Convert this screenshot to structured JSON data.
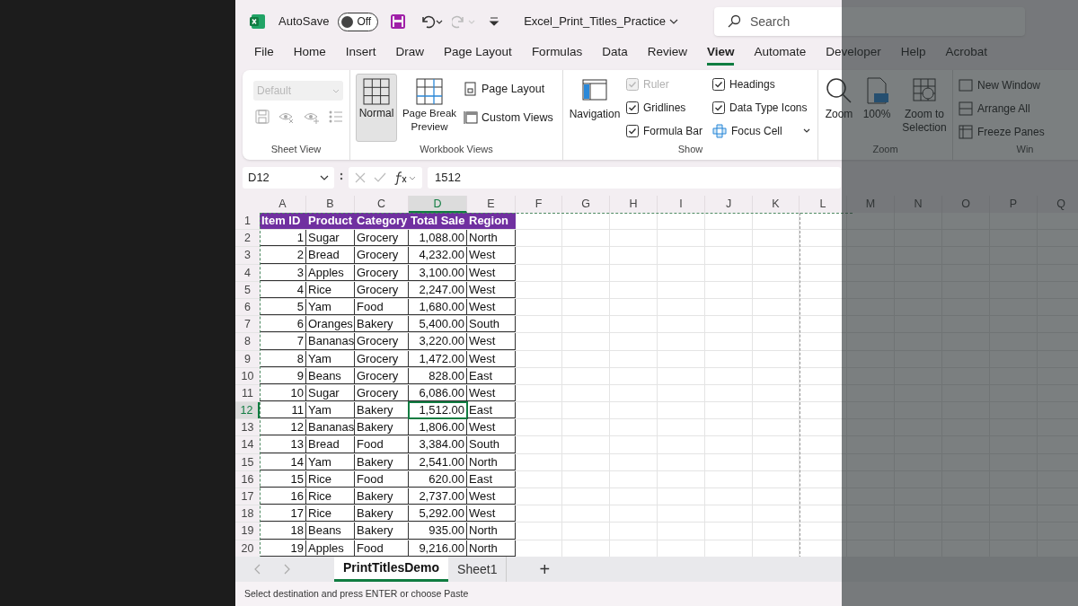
{
  "title_bar": {
    "autosave_label": "AutoSave",
    "autosave_toggle": {
      "label": "Off",
      "on": false
    },
    "file_name": "Excel_Print_Titles_Practice",
    "search": {
      "placeholder": "Search"
    }
  },
  "ribbon_tabs": [
    {
      "label": "File",
      "selected": false
    },
    {
      "label": "Home",
      "selected": false
    },
    {
      "label": "Insert",
      "selected": false
    },
    {
      "label": "Draw",
      "selected": false
    },
    {
      "label": "Page Layout",
      "selected": false
    },
    {
      "label": "Formulas",
      "selected": false
    },
    {
      "label": "Data",
      "selected": false
    },
    {
      "label": "Review",
      "selected": false
    },
    {
      "label": "View",
      "selected": true
    },
    {
      "label": "Automate",
      "selected": false
    },
    {
      "label": "Developer",
      "selected": false
    },
    {
      "label": "Help",
      "selected": false
    },
    {
      "label": "Acrobat",
      "selected": false
    }
  ],
  "ribbon": {
    "sheet_view": {
      "label": "Sheet View",
      "view_select": {
        "placeholder": "Default",
        "disabled": true
      }
    },
    "workbook_views": {
      "label": "Workbook Views",
      "large_buttons": [
        {
          "label": "Normal",
          "selected": true
        },
        {
          "label": "Page Break Preview",
          "selected": false
        }
      ],
      "small_buttons": [
        "Page Layout",
        "Custom Views"
      ]
    },
    "show": {
      "label": "Show",
      "navigation": "Navigation",
      "checkboxes": [
        {
          "label": "Ruler",
          "checked": true,
          "disabled": true
        },
        {
          "label": "Gridlines",
          "checked": true,
          "disabled": false
        },
        {
          "label": "Formula Bar",
          "checked": true,
          "disabled": false
        },
        {
          "label": "Headings",
          "checked": true,
          "disabled": false
        },
        {
          "label": "Data Type Icons",
          "checked": true,
          "disabled": false
        }
      ],
      "focus_cell": "Focus Cell"
    },
    "zoom": {
      "label": "Zoom",
      "buttons": [
        "Zoom",
        "100%",
        "Zoom to Selection"
      ]
    },
    "window": {
      "label": "Win",
      "items": [
        "New Window",
        "Arrange All",
        "Freeze Panes"
      ]
    }
  },
  "formula_bar": {
    "name_box": "D12",
    "value": "1512"
  },
  "sheet": {
    "columns": [
      {
        "label": "A",
        "selected": false
      },
      {
        "label": "B",
        "selected": false
      },
      {
        "label": "C",
        "selected": false
      },
      {
        "label": "D",
        "selected": true
      },
      {
        "label": "E",
        "selected": false
      },
      {
        "label": "F",
        "selected": false
      },
      {
        "label": "G",
        "selected": false
      },
      {
        "label": "H",
        "selected": false
      },
      {
        "label": "I",
        "selected": false
      },
      {
        "label": "J",
        "selected": false
      },
      {
        "label": "K",
        "selected": false
      },
      {
        "label": "L",
        "selected": false
      },
      {
        "label": "M",
        "selected": false
      },
      {
        "label": "N",
        "selected": false
      },
      {
        "label": "O",
        "selected": false
      },
      {
        "label": "P",
        "selected": false
      },
      {
        "label": "Q",
        "selected": false
      }
    ],
    "header": [
      "Item ID",
      "Product",
      "Category",
      "Total Sale",
      "Region"
    ],
    "rows": [
      [
        "1",
        "Sugar",
        "Grocery",
        "1,088.00",
        "North"
      ],
      [
        "2",
        "Bread",
        "Grocery",
        "4,232.00",
        "West"
      ],
      [
        "3",
        "Apples",
        "Grocery",
        "3,100.00",
        "West"
      ],
      [
        "4",
        "Rice",
        "Grocery",
        "2,247.00",
        "West"
      ],
      [
        "5",
        "Yam",
        "Food",
        "1,680.00",
        "West"
      ],
      [
        "6",
        "Oranges",
        "Bakery",
        "5,400.00",
        "South"
      ],
      [
        "7",
        "Bananas",
        "Grocery",
        "3,220.00",
        "West"
      ],
      [
        "8",
        "Yam",
        "Grocery",
        "1,472.00",
        "West"
      ],
      [
        "9",
        "Beans",
        "Grocery",
        "828.00",
        "East"
      ],
      [
        "10",
        "Sugar",
        "Grocery",
        "6,086.00",
        "West"
      ],
      [
        "11",
        "Yam",
        "Bakery",
        "1,512.00",
        "East"
      ],
      [
        "12",
        "Bananas",
        "Bakery",
        "1,806.00",
        "West"
      ],
      [
        "13",
        "Bread",
        "Food",
        "3,384.00",
        "South"
      ],
      [
        "14",
        "Yam",
        "Bakery",
        "2,541.00",
        "North"
      ],
      [
        "15",
        "Rice",
        "Food",
        "620.00",
        "East"
      ],
      [
        "16",
        "Rice",
        "Bakery",
        "2,737.00",
        "West"
      ],
      [
        "17",
        "Rice",
        "Bakery",
        "5,292.00",
        "West"
      ],
      [
        "18",
        "Beans",
        "Bakery",
        "935.00",
        "North"
      ],
      [
        "19",
        "Apples",
        "Food",
        "9,216.00",
        "North"
      ]
    ],
    "row_numbers": [
      {
        "label": "1",
        "selected": false
      },
      {
        "label": "2",
        "selected": false
      },
      {
        "label": "3",
        "selected": false
      },
      {
        "label": "4",
        "selected": false
      },
      {
        "label": "5",
        "selected": false
      },
      {
        "label": "6",
        "selected": false
      },
      {
        "label": "7",
        "selected": false
      },
      {
        "label": "8",
        "selected": false
      },
      {
        "label": "9",
        "selected": false
      },
      {
        "label": "10",
        "selected": false
      },
      {
        "label": "11",
        "selected": false
      },
      {
        "label": "12",
        "selected": true
      },
      {
        "label": "13",
        "selected": false
      },
      {
        "label": "14",
        "selected": false
      },
      {
        "label": "15",
        "selected": false
      },
      {
        "label": "16",
        "selected": false
      },
      {
        "label": "17",
        "selected": false
      },
      {
        "label": "18",
        "selected": false
      },
      {
        "label": "19",
        "selected": false
      },
      {
        "label": "20",
        "selected": false
      }
    ]
  },
  "sheet_tabs": [
    {
      "label": "PrintTitlesDemo",
      "selected": true
    },
    {
      "label": "Sheet1",
      "selected": false
    }
  ],
  "add_sheet": "+",
  "status_bar": "Select destination and press ENTER or choose Paste"
}
